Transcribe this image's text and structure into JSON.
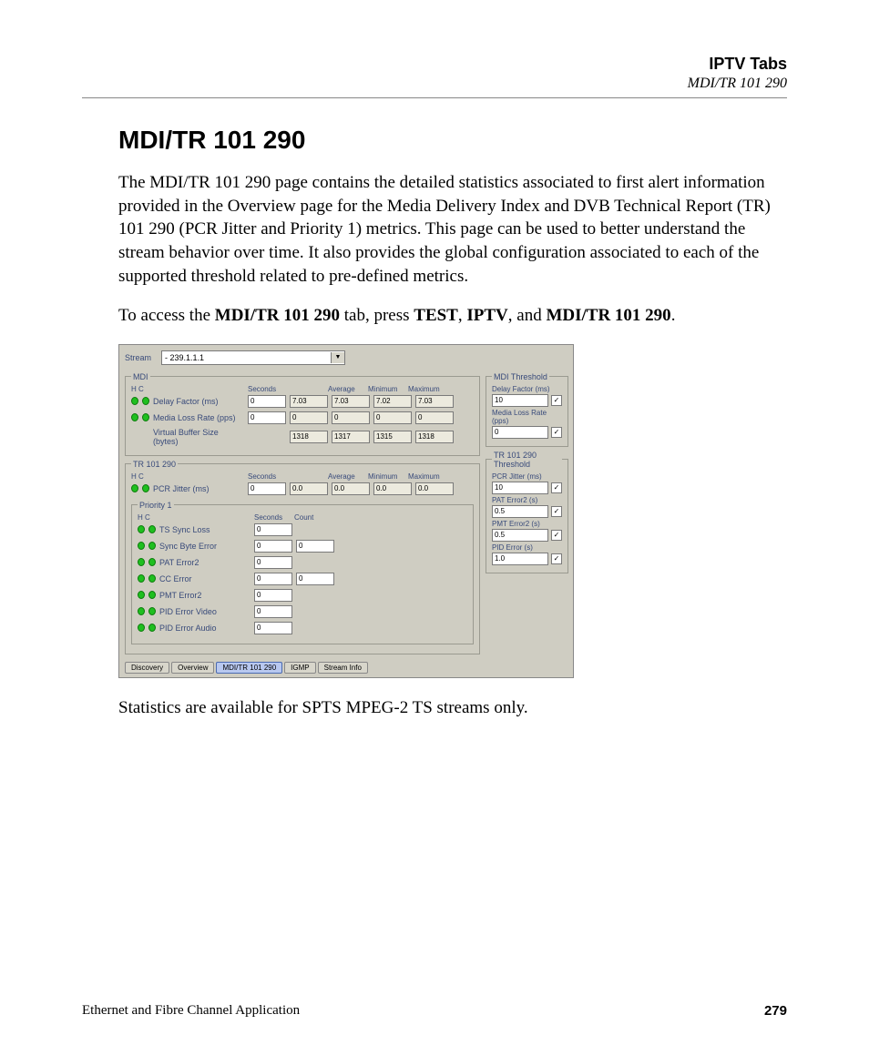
{
  "header": {
    "title": "IPTV Tabs",
    "subtitle": "MDI/TR 101 290"
  },
  "h1": "MDI/TR 101 290",
  "para1": "The MDI/TR 101 290 page contains the detailed statistics associated to first alert information provided in the Overview page for the Media Delivery Index and DVB Technical Report (TR) 101 290 (PCR Jitter and Priority 1) metrics. This page can be used to better understand the stream behavior over time. It also provides the global configuration associated to each of the supported threshold related to pre-defined metrics.",
  "para2": {
    "pre": "To access the ",
    "b1": "MDI/TR 101 290",
    "mid1": " tab, press ",
    "b2": "TEST",
    "mid2": ", ",
    "b3": "IPTV",
    "mid3": ", and ",
    "b4": "MDI/TR 101 290",
    "post": "."
  },
  "para3": "Statistics are available for SPTS MPEG-2 TS streams only.",
  "ui": {
    "stream_label": "Stream",
    "stream_value": "- 239.1.1.1",
    "mdi": {
      "legend": "MDI",
      "cols": {
        "hc": "H   C",
        "seconds": "Seconds",
        "average": "Average",
        "minimum": "Minimum",
        "maximum": "Maximum"
      },
      "rows": [
        {
          "name": "Delay Factor (ms)",
          "sec": "0",
          "v1": "7.03",
          "avg": "7.03",
          "min": "7.02",
          "max": "7.03"
        },
        {
          "name": "Media Loss Rate (pps)",
          "sec": "0",
          "v1": "0",
          "avg": "0",
          "min": "0",
          "max": "0"
        },
        {
          "name": "Virtual Buffer Size (bytes)",
          "sec": "",
          "v1": "1318",
          "avg": "1317",
          "min": "1315",
          "max": "1318",
          "nodots": true
        }
      ]
    },
    "tr": {
      "legend": "TR 101 290",
      "cols": {
        "hc": "H   C",
        "seconds": "Seconds",
        "average": "Average",
        "minimum": "Minimum",
        "maximum": "Maximum"
      },
      "rows": [
        {
          "name": "PCR Jitter (ms)",
          "sec": "0",
          "v1": "0.0",
          "avg": "0.0",
          "min": "0.0",
          "max": "0.0"
        }
      ]
    },
    "p1": {
      "legend": "Priority 1",
      "cols": {
        "hc": "H   C",
        "seconds": "Seconds",
        "count": "Count"
      },
      "rows": [
        {
          "name": "TS Sync Loss",
          "sec": "0"
        },
        {
          "name": "Sync Byte Error",
          "sec": "0",
          "count": "0"
        },
        {
          "name": "PAT Error2",
          "sec": "0"
        },
        {
          "name": "CC Error",
          "sec": "0",
          "count": "0"
        },
        {
          "name": "PMT Error2",
          "sec": "0"
        },
        {
          "name": "PID Error Video",
          "sec": "0"
        },
        {
          "name": "PID Error Audio",
          "sec": "0"
        }
      ]
    },
    "mdi_thr": {
      "legend": "MDI Threshold",
      "rows": [
        {
          "label": "Delay Factor (ms)",
          "val": "10",
          "chk": "✓"
        },
        {
          "label": "Media Loss Rate (pps)",
          "val": "0",
          "chk": "✓"
        }
      ]
    },
    "tr_thr": {
      "legend": "TR 101 290 Threshold",
      "rows": [
        {
          "label": "PCR Jitter (ms)",
          "val": "10",
          "chk": "✓"
        },
        {
          "label": "PAT Error2 (s)",
          "val": "0.5",
          "chk": "✓"
        },
        {
          "label": "PMT Error2 (s)",
          "val": "0.5",
          "chk": "✓"
        },
        {
          "label": "PID Error (s)",
          "val": "1.0",
          "chk": "✓"
        }
      ]
    },
    "tabs": [
      "Discovery",
      "Overview",
      "MDI/TR 101 290",
      "IGMP",
      "Stream Info"
    ],
    "active_tab": 2
  },
  "footer": {
    "left": "Ethernet and Fibre Channel Application",
    "right": "279"
  }
}
